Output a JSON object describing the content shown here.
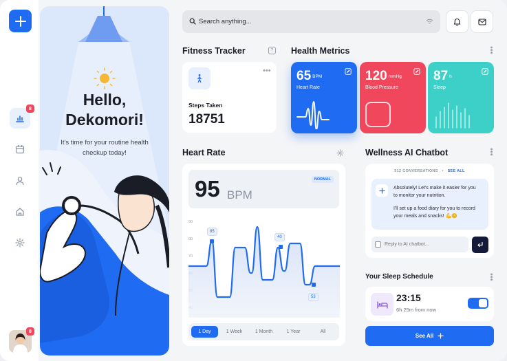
{
  "sidebar": {
    "badge_top": "8",
    "badge_avatar": "8",
    "items": [
      {
        "icon": "chart-bars-icon",
        "active": true
      },
      {
        "icon": "calendar-icon",
        "active": false
      },
      {
        "icon": "user-icon",
        "active": false
      },
      {
        "icon": "home-icon",
        "active": false
      },
      {
        "icon": "gear-icon",
        "active": false
      }
    ]
  },
  "hero": {
    "greeting_line1": "Hello,",
    "greeting_line2": "Dekomori!",
    "subtitle_line1": "It's time for your routine health",
    "subtitle_line2": "checkup today!"
  },
  "search": {
    "placeholder": "Search anything..."
  },
  "fitness": {
    "title": "Fitness Tracker",
    "help": "?",
    "label": "Steps Taken",
    "value": "18751"
  },
  "health_metrics": {
    "title": "Health Metrics",
    "cards": [
      {
        "value": "65",
        "unit": "BPM",
        "name": "Heart Rate",
        "color": "#1f6bf2"
      },
      {
        "value": "120",
        "unit": "mmHg",
        "name": "Blood Pressure",
        "color": "#f0475c"
      },
      {
        "value": "87",
        "unit": "h",
        "name": "Sleep",
        "color": "#3dd0c8"
      }
    ]
  },
  "heart_rate": {
    "title": "Heart Rate",
    "value": "95",
    "unit": "BPM",
    "status": "NORMAL",
    "y_ticks": [
      "90",
      "80",
      "70",
      "60",
      "50",
      "40"
    ],
    "label_high": "85",
    "label_mid": "40",
    "label_low": "53",
    "ranges": [
      "1 Day",
      "1 Week",
      "1 Month",
      "1 Year",
      "All"
    ],
    "selected_range": "1 Day"
  },
  "chatbot": {
    "title": "Wellness AI Chatbot",
    "conversations": "512 CONVERSATIONS",
    "see_all": "SEE ALL",
    "msg1_line1": "Absolutely! Let's make it easier for you",
    "msg1_line2": "to monitor your nutrition.",
    "msg2_line1": "I'll set up a food diary for you to record",
    "msg2_line2": "your meals and snacks! 💪😊",
    "reply_placeholder": "Reply to AI chatbot..."
  },
  "sleep": {
    "title": "Your Sleep Schedule",
    "time": "23:15",
    "from_now": "6h 25m from now",
    "toggle_on": true,
    "see_all": "See All"
  },
  "colors": {
    "accent": "#1f6bf2",
    "red": "#f0475c",
    "teal": "#3dd0c8",
    "dark": "#1a1d26"
  }
}
